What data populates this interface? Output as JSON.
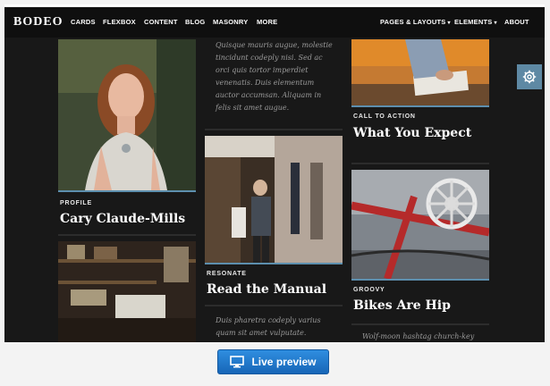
{
  "nav": {
    "logo": "BODEO",
    "items": [
      "CARDS",
      "FLEXBOX",
      "CONTENT",
      "BLOG",
      "MASONRY",
      "MORE"
    ],
    "right_items": [
      "PAGES & LAYOUTS",
      "ELEMENTS",
      "ABOUT"
    ]
  },
  "cards": {
    "profile": {
      "kicker": "PROFILE",
      "title": "Cary Claude-Mills"
    },
    "resonate": {
      "kicker": "RESONATE",
      "title": "Read the Manual"
    },
    "cta": {
      "kicker": "CALL TO ACTION",
      "title": "What You Expect"
    },
    "groovy": {
      "kicker": "GROOVY",
      "title": "Bikes Are Hip"
    }
  },
  "texts": {
    "quote1": "Quisque mauris augue, molestie tincidunt codeply nisi. Sed ac orci quis tortor imperdiet venenatis. Duis elementum auctor accumsan. Aliquam in felis sit amet augue.",
    "quote2": "Duis pharetra codeply varius quam sit amet vulputate.",
    "quote3": "Wolf-moon hashtag church-key"
  },
  "preview_button": {
    "label": "Live preview",
    "icon": "monitor-icon"
  },
  "settings": {
    "icon": "gear-icon"
  },
  "colors": {
    "accent": "#5d8fae",
    "background": "#181818",
    "button": "#1f7ad0"
  }
}
